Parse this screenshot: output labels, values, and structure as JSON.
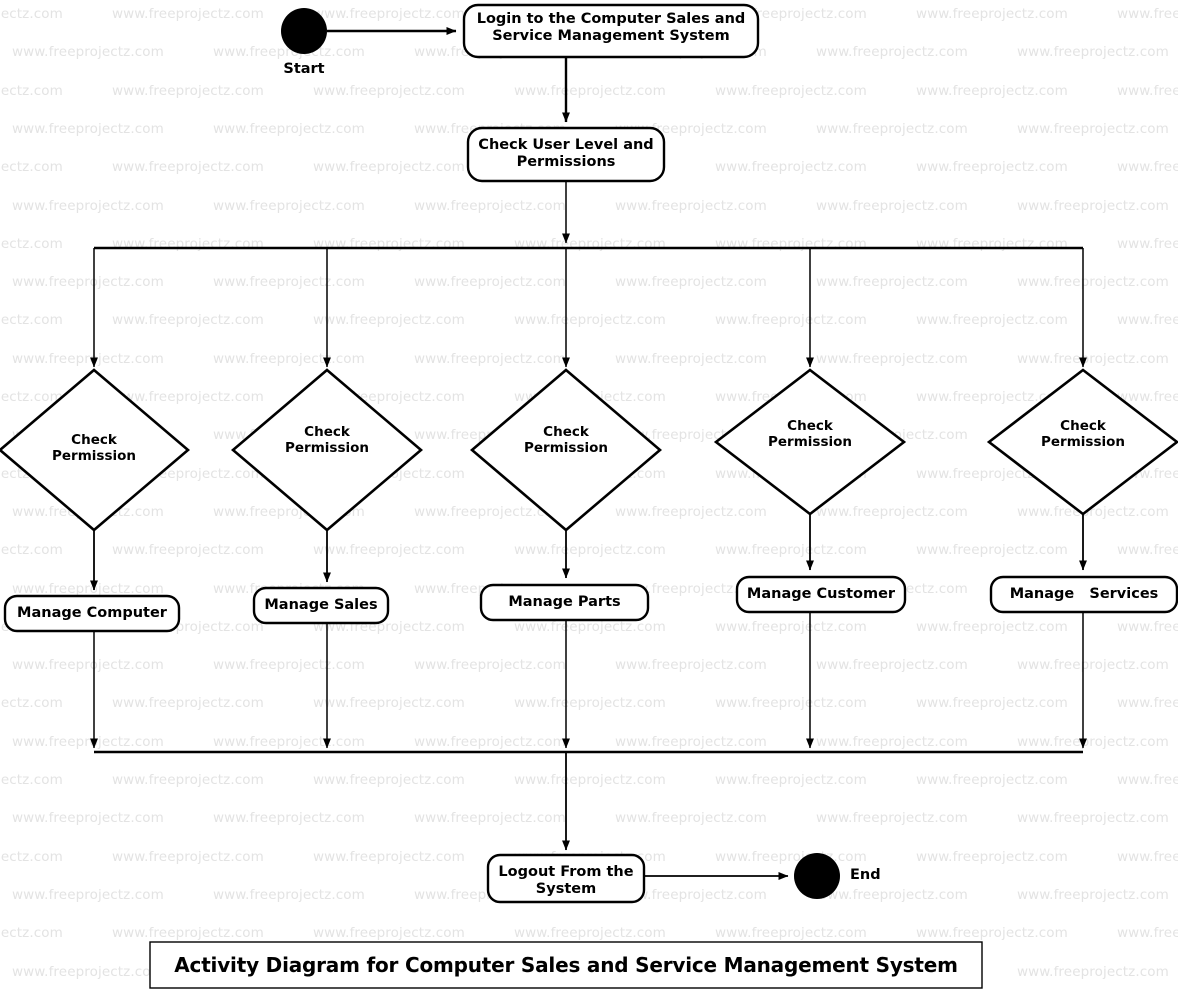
{
  "diagram": {
    "caption": "Activity Diagram for Computer Sales and Service Management System",
    "watermark_text": "www.freeprojectz.com",
    "colors": {
      "stroke": "#000000",
      "fill": "#ffffff",
      "watermark": "#e3e3e3",
      "text": "#000000"
    }
  },
  "nodes": {
    "start": {
      "label": "Start",
      "type": "initial-node"
    },
    "login": {
      "line1": "Login to the Computer Sales and",
      "line2": "Service Management System",
      "type": "activity"
    },
    "check_user": {
      "line1": "Check User Level and",
      "line2": "Permissions",
      "type": "activity"
    },
    "logout": {
      "line1": "Logout From the",
      "line2": "System",
      "type": "activity"
    },
    "end": {
      "label": "End",
      "type": "final-node"
    }
  },
  "branches": [
    {
      "id": "computer",
      "decision_line1": "Check",
      "decision_line2": "Permission",
      "activity": "Manage Computer"
    },
    {
      "id": "sales",
      "decision_line1": "Check",
      "decision_line2": "Permission",
      "activity": "Manage Sales"
    },
    {
      "id": "parts",
      "decision_line1": "Check",
      "decision_line2": "Permission",
      "activity": "Manage Parts"
    },
    {
      "id": "customer",
      "decision_line1": "Check",
      "decision_line2": "Permission",
      "activity": "Manage Customer"
    },
    {
      "id": "services",
      "decision_line1": "Check",
      "decision_line2": "Permission",
      "activity": "Manage   Services"
    }
  ]
}
